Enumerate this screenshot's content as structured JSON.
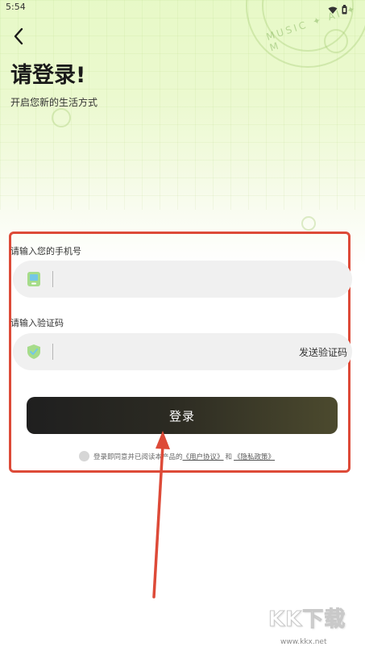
{
  "status_bar": {
    "time": "5:54"
  },
  "header": {
    "title": "请登录!",
    "subtitle": "开启您新的生活方式"
  },
  "phone_field": {
    "label": "请输入您的手机号",
    "value": ""
  },
  "code_field": {
    "label": "请输入验证码",
    "value": "",
    "send_code_label": "发送验证码"
  },
  "login_button": {
    "label": "登录"
  },
  "agreement": {
    "prefix": "登录即同意并已阅读本产品的",
    "user_agreement": "《用户协议》",
    "connector": "和",
    "privacy_policy": "《隐私政策》"
  },
  "decoration": {
    "ring_text": "MUSIC ✦ AI ✦ M"
  },
  "watermark": {
    "logo": "KK下载",
    "url": "www.kkx.net"
  },
  "colors": {
    "highlight": "#dd4a38",
    "button_start": "#1f1f1f",
    "button_end": "#4c4a2e",
    "bg_top": "#e7f9c7"
  },
  "icons": {
    "back": "chevron-left-icon",
    "phone": "phone-icon",
    "shield": "shield-check-icon",
    "wifi": "wifi-icon",
    "battery": "battery-icon"
  }
}
